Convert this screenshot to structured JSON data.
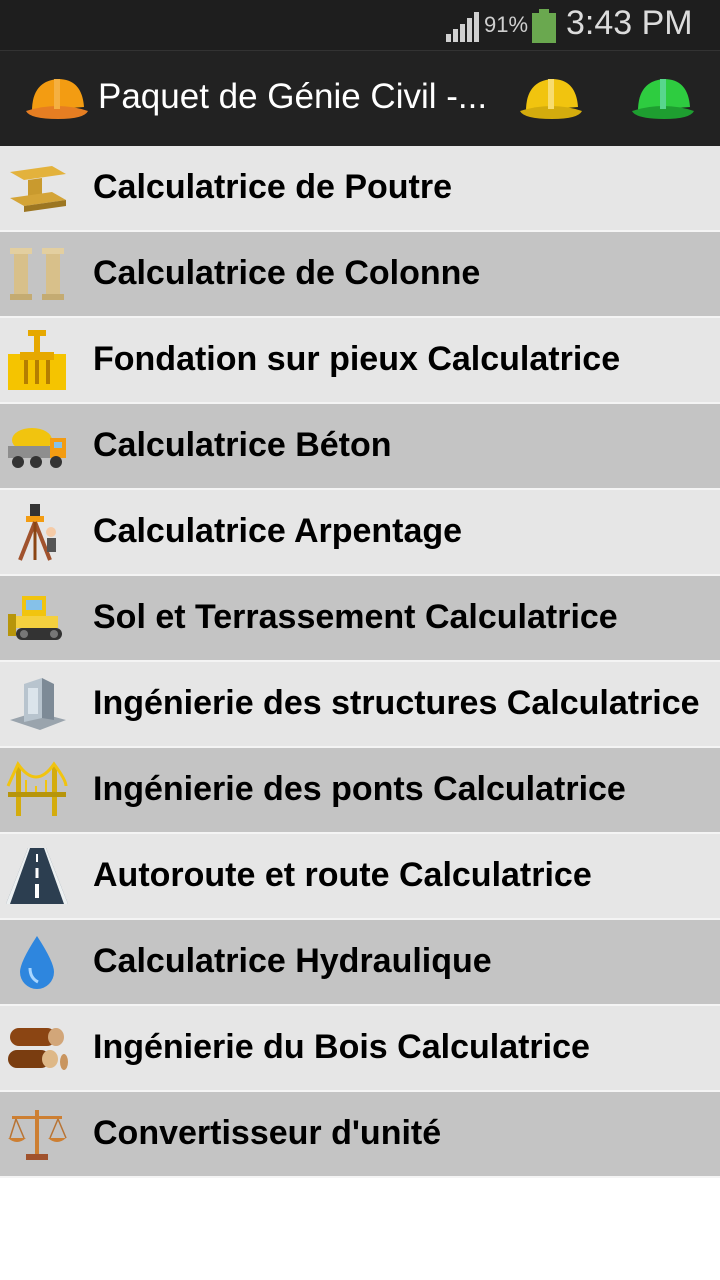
{
  "status_bar": {
    "battery_percent": "91%",
    "time": "3:43 PM"
  },
  "action_bar": {
    "title": "Paquet de Génie Civil -..."
  },
  "menu": {
    "items": [
      {
        "label": "Calculatrice de Poutre",
        "icon": "steel-beam-icon"
      },
      {
        "label": "Calculatrice de Colonne",
        "icon": "columns-icon"
      },
      {
        "label": "Fondation sur pieux Calculatrice",
        "icon": "pile-foundation-icon"
      },
      {
        "label": "Calculatrice Béton",
        "icon": "concrete-mixer-truck-icon"
      },
      {
        "label": "Calculatrice Arpentage",
        "icon": "surveying-tripod-icon"
      },
      {
        "label": "Sol et Terrassement Calculatrice",
        "icon": "bulldozer-icon"
      },
      {
        "label": "Ingénierie des structures Calculatrice",
        "icon": "building-icon"
      },
      {
        "label": "Ingénierie des ponts Calculatrice",
        "icon": "bridge-icon"
      },
      {
        "label": "Autoroute et route Calculatrice",
        "icon": "road-icon"
      },
      {
        "label": "Calculatrice Hydraulique",
        "icon": "water-drop-icon"
      },
      {
        "label": "Ingénierie du Bois Calculatrice",
        "icon": "wood-logs-icon"
      },
      {
        "label": "Convertisseur d'unité",
        "icon": "balance-scale-icon"
      }
    ]
  },
  "colors": {
    "row_light": "#e6e6e6",
    "row_dark": "#c4c4c4",
    "action_bar": "#222222",
    "status_bar": "#1e1e1e"
  }
}
